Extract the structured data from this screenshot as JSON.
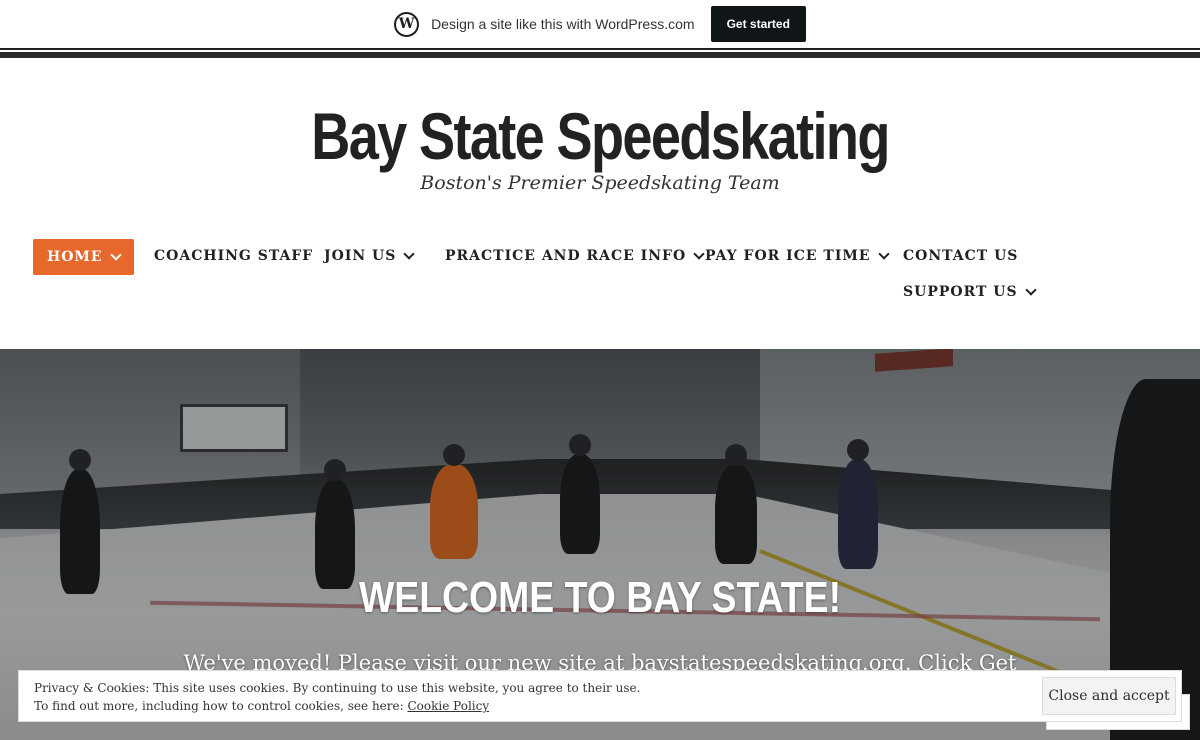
{
  "wp_bar": {
    "logo_letter": "W",
    "text": "Design a site like this with WordPress.com",
    "button": "Get started"
  },
  "header": {
    "title": "Bay State Speedskating",
    "description": "Boston's Premier Speedskating Team"
  },
  "nav": {
    "items": [
      {
        "label": "HOME",
        "active": true,
        "dropdown": true
      },
      {
        "label": "COACHING STAFF",
        "active": false,
        "dropdown": false
      },
      {
        "label": "JOIN US",
        "active": false,
        "dropdown": true
      },
      {
        "label": "PRACTICE AND RACE INFO",
        "active": false,
        "dropdown": true
      },
      {
        "label": "PAY FOR ICE TIME",
        "active": false,
        "dropdown": true
      },
      {
        "label": "CONTACT US",
        "active": false,
        "dropdown": false
      },
      {
        "label": "SUPPORT US",
        "active": false,
        "dropdown": true
      }
    ]
  },
  "hero": {
    "title": "WELCOME TO BAY STATE!",
    "text": "We've moved! Please visit our new site at baystatespeedskating.org. Click Get"
  },
  "cookie": {
    "line1": "Privacy & Cookies: This site uses cookies. By continuing to use this website, you agree to their use.",
    "line2_prefix": "To find out more, including how to control cookies, see here: ",
    "link": "Cookie Policy",
    "button": "Close and accept"
  },
  "colors": {
    "accent": "#e8672a",
    "wp_button": "#101517",
    "text_dark": "#222222"
  }
}
